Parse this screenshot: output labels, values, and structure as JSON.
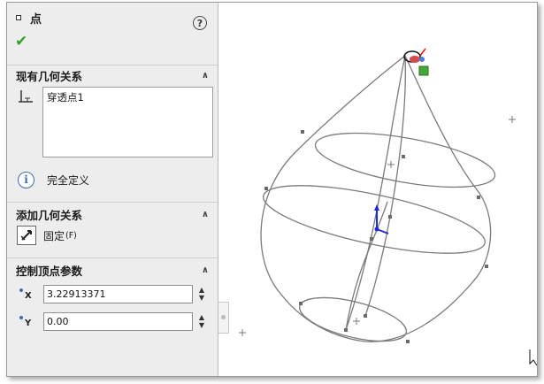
{
  "panel": {
    "title": "点",
    "help": "?",
    "ok_symbol": "✔",
    "existing_relations": {
      "header": "现有几何关系",
      "items": [
        "穿透点1"
      ]
    },
    "status": {
      "icon": "i",
      "text": "完全定义"
    },
    "add_relations": {
      "header": "添加几何关系",
      "fix_label": "固定",
      "fix_shortcut": "(F)"
    },
    "control_params": {
      "header": "控制顶点参数",
      "x_axis": "X",
      "x_value": "3.22913371",
      "y_axis": "Y",
      "y_value": "0.00"
    }
  },
  "viewport": {
    "background": "#ffffff",
    "sketch_color": "#7a7a7a",
    "triad_color": "#1f2bd6"
  }
}
